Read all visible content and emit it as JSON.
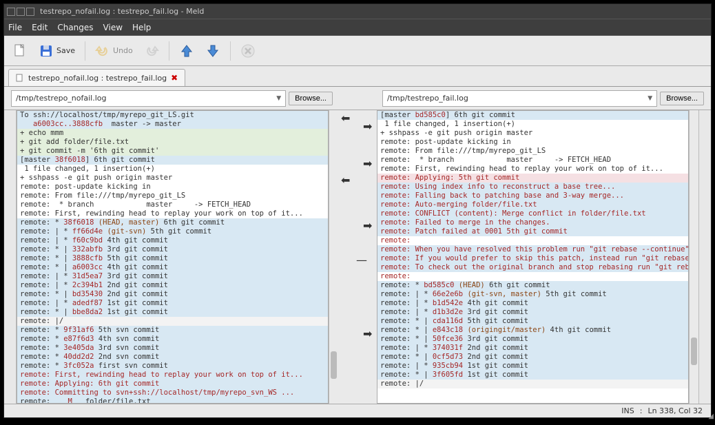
{
  "title": "testrepo_nofail.log : testrepo_fail.log - Meld",
  "menus": {
    "file": "File",
    "edit": "Edit",
    "changes": "Changes",
    "view": "View",
    "help": "Help"
  },
  "toolbar": {
    "save": "Save",
    "undo": "Undo"
  },
  "tab": {
    "label": "testrepo_nofail.log : testrepo_fail.log"
  },
  "files": {
    "left": "/tmp/testrepo_nofail.log",
    "right": "/tmp/testrepo_fail.log",
    "browse": "Browse..."
  },
  "left_lines": [
    {
      "cls": "bg-blue",
      "t": "To ssh://localhost/tmp/myrepo_git_LS.git"
    },
    {
      "cls": "bg-blue",
      "pre": "   ",
      "hash": "a6003cc..3888cfb",
      "post": "  master -> master"
    },
    {
      "cls": "bg-green",
      "t": "+ echo mmm"
    },
    {
      "cls": "bg-green",
      "t": "+ git add folder/file.txt"
    },
    {
      "cls": "bg-green",
      "t": "+ git commit -m '6th git commit'"
    },
    {
      "cls": "bg-blue",
      "pre": "[master ",
      "hash": "38f6018",
      "post": "] 6th git commit"
    },
    {
      "cls": "",
      "t": " 1 file changed, 1 insertion(+)"
    },
    {
      "cls": "",
      "t": "+ sshpass -e git push origin master"
    },
    {
      "cls": "",
      "t": "remote: post-update kicking in"
    },
    {
      "cls": "",
      "t": "remote: From file:///tmp/myrepo_git_LS"
    },
    {
      "cls": "",
      "t": "remote:  * branch            master     -> FETCH_HEAD"
    },
    {
      "cls": "",
      "t": "remote: First, rewinding head to replay your work on top of it..."
    },
    {
      "cls": "bg-blue",
      "pre": "remote: * ",
      "hash": "38f6018",
      "brown": " (HEAD, master)",
      "post": " 6th git commit"
    },
    {
      "cls": "bg-blue",
      "pre": "remote: | * ",
      "hash": "ff66d4e",
      "brown": " (git-svn)",
      "post": " 5th git commit"
    },
    {
      "cls": "bg-blue",
      "pre": "remote: | * ",
      "hash": "f60c9bd",
      "post": " 4th git commit"
    },
    {
      "cls": "bg-blue",
      "pre": "remote: * | ",
      "hash": "332abfb",
      "post": " 3rd git commit"
    },
    {
      "cls": "bg-blue",
      "pre": "remote: * | ",
      "hash": "3888cfb",
      "post": " 5th git commit"
    },
    {
      "cls": "bg-blue",
      "pre": "remote: * | ",
      "hash": "a6003cc",
      "post": " 4th git commit"
    },
    {
      "cls": "bg-blue",
      "pre": "remote: | * ",
      "hash": "31d5ea7",
      "post": " 3rd git commit"
    },
    {
      "cls": "bg-blue",
      "pre": "remote: | * ",
      "hash": "2c394b1",
      "post": " 2nd git commit"
    },
    {
      "cls": "bg-blue",
      "pre": "remote: * | ",
      "hash": "bd35430",
      "post": " 2nd git commit"
    },
    {
      "cls": "bg-blue",
      "pre": "remote: | * ",
      "hash": "adedf87",
      "post": " 1st git commit"
    },
    {
      "cls": "bg-blue",
      "pre": "remote: * | ",
      "hash": "bbe8da2",
      "post": " 1st git commit"
    },
    {
      "cls": "bg-grey",
      "t": "remote: |/"
    },
    {
      "cls": "bg-blue",
      "pre": "remote: * ",
      "hash": "9f31af6",
      "post": " 5th svn commit"
    },
    {
      "cls": "bg-blue",
      "pre": "remote: * ",
      "hash": "e87f6d3",
      "post": " 4th svn commit"
    },
    {
      "cls": "bg-blue",
      "pre": "remote: * ",
      "hash": "3e405da",
      "post": " 3rd svn commit"
    },
    {
      "cls": "bg-blue",
      "pre": "remote: * ",
      "hash": "40dd2d2",
      "post": " 2nd svn commit"
    },
    {
      "cls": "bg-blue",
      "pre": "remote: * ",
      "hash": "3fc052a",
      "post": " first svn commit"
    },
    {
      "cls": "bg-blue",
      "pre": "",
      "redtext": "remote: First, rewinding head to replay your work on top of it..."
    },
    {
      "cls": "bg-blue",
      "pre": "",
      "redtext": "remote: Applying: 6th git commit"
    },
    {
      "cls": "bg-blue",
      "pre": "",
      "redtext": "remote: Committing to svn+ssh://localhost/tmp/myrepo_svn_WS ..."
    },
    {
      "cls": "bg-blue",
      "pre": "remote:    ",
      "hash": "M",
      "post": "   folder/file.txt"
    }
  ],
  "right_lines": [
    {
      "cls": "bg-blue",
      "pre": "[master ",
      "hash": "bd585c0",
      "post": "] 6th git commit"
    },
    {
      "cls": "",
      "t": " 1 file changed, 1 insertion(+)"
    },
    {
      "cls": "",
      "t": "+ sshpass -e git push origin master"
    },
    {
      "cls": "",
      "t": "remote: post-update kicking in"
    },
    {
      "cls": "",
      "t": "remote: From file:///tmp/myrepo_git_LS"
    },
    {
      "cls": "",
      "t": "remote:  * branch            master     -> FETCH_HEAD"
    },
    {
      "cls": "",
      "t": "remote: First, rewinding head to replay your work on top of it..."
    },
    {
      "cls": "bg-pink",
      "pre": "",
      "redtext": "remote: Applying: 5th git commit"
    },
    {
      "cls": "bg-blue",
      "pre": "",
      "redtext": "remote: Using index info to reconstruct a base tree..."
    },
    {
      "cls": "bg-blue",
      "pre": "",
      "redtext": "remote: Falling back to patching base and 3-way merge..."
    },
    {
      "cls": "bg-blue",
      "pre": "",
      "redtext": "remote: Auto-merging folder/file.txt"
    },
    {
      "cls": "bg-blue",
      "pre": "",
      "redtext": "remote: CONFLICT (content): Merge conflict in folder/file.txt"
    },
    {
      "cls": "bg-blue",
      "pre": "",
      "redtext": "remote: Failed to merge in the changes."
    },
    {
      "cls": "bg-blue",
      "pre": "",
      "redtext": "remote: Patch failed at 0001 5th git commit"
    },
    {
      "cls": "",
      "pre": "",
      "redtext": "remote:"
    },
    {
      "cls": "bg-blue",
      "pre": "",
      "redtext": "remote: When you have resolved this problem run \"git rebase --continue\"."
    },
    {
      "cls": "bg-blue",
      "pre": "",
      "redtext": "remote: If you would prefer to skip this patch, instead run \"git rebase --skip\"."
    },
    {
      "cls": "bg-blue",
      "pre": "",
      "redtext": "remote: To check out the original branch and stop rebasing run \"git rebase --abort\"."
    },
    {
      "cls": "",
      "pre": "",
      "redtext": "remote:"
    },
    {
      "cls": "bg-blue",
      "pre": "remote: * ",
      "hash": "bd585c0",
      "brown": " (HEAD)",
      "post": " 6th git commit"
    },
    {
      "cls": "bg-blue",
      "pre": "remote: | * ",
      "hash": "66e2e6b",
      "brown": " (git-svn, master)",
      "post": " 5th git commit"
    },
    {
      "cls": "bg-blue",
      "pre": "remote: | * ",
      "hash": "b1d542e",
      "post": " 4th git commit"
    },
    {
      "cls": "bg-blue",
      "pre": "remote: | * ",
      "hash": "d1b3d2e",
      "post": " 3rd git commit"
    },
    {
      "cls": "bg-blue",
      "pre": "remote: * | ",
      "hash": "cda116d",
      "post": " 5th git commit"
    },
    {
      "cls": "bg-blue",
      "pre": "remote: * | ",
      "hash": "e843c18",
      "brown": " (origingit/master)",
      "post": " 4th git commit"
    },
    {
      "cls": "bg-blue",
      "pre": "remote: * | ",
      "hash": "50fce36",
      "post": " 3rd git commit"
    },
    {
      "cls": "bg-blue",
      "pre": "remote: | * ",
      "hash": "374031f",
      "post": " 2nd git commit"
    },
    {
      "cls": "bg-blue",
      "pre": "remote: * | ",
      "hash": "0cf5d73",
      "post": " 2nd git commit"
    },
    {
      "cls": "bg-blue",
      "pre": "remote: | * ",
      "hash": "935cb94",
      "post": " 1st git commit"
    },
    {
      "cls": "bg-blue",
      "pre": "remote: * | ",
      "hash": "3f605fd",
      "post": " 1st git commit"
    },
    {
      "cls": "bg-grey",
      "t": "remote: |/"
    }
  ],
  "status": {
    "mode": "INS",
    "pos": "Ln 338, Col 32"
  }
}
